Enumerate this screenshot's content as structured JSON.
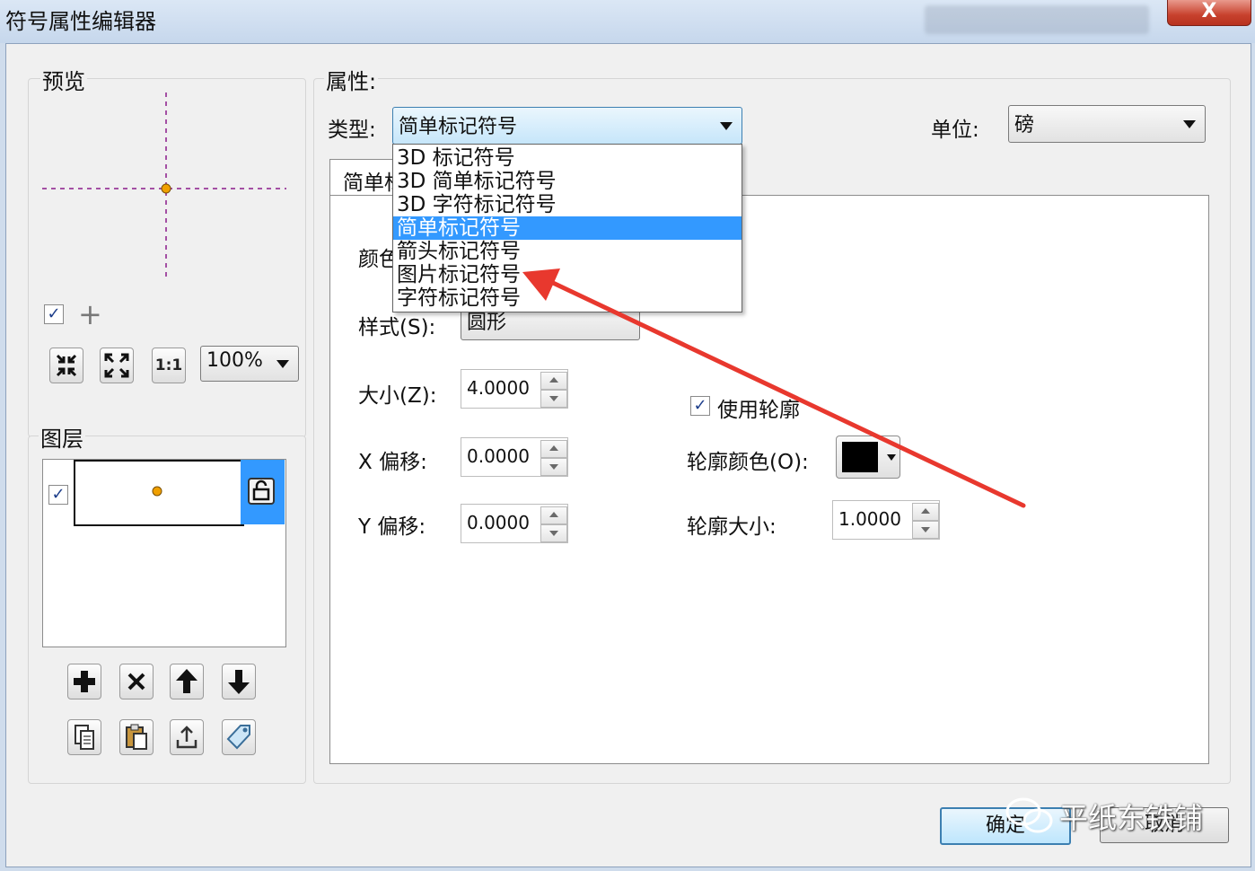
{
  "window": {
    "title": "符号属性编辑器",
    "close_glyph": "X"
  },
  "preview": {
    "label": "预览",
    "zoom_value": "100%",
    "show_crosshair_checked": true,
    "tools": [
      "zoom-in-icon",
      "zoom-extent-icon",
      "one-to-one-icon"
    ],
    "one_to_one_text": "1:1"
  },
  "layers": {
    "label": "图层",
    "items": [
      {
        "checked": true,
        "locked_icon": "lock-icon"
      }
    ],
    "buttons": [
      "add-icon",
      "delete-icon",
      "move-up-icon",
      "move-down-icon"
    ],
    "buttons2": [
      "copy-icon",
      "paste-icon",
      "export-icon",
      "tag-icon"
    ]
  },
  "properties": {
    "label": "属性:",
    "type_label": "类型:",
    "type_value": "简单标记符号",
    "unit_label": "单位:",
    "unit_value": "磅",
    "tab_label": "简单标记",
    "color_label": "颜色",
    "style_label": "样式(S):",
    "style_value": "圆形",
    "size_label": "大小(Z):",
    "size_value": "4.0000",
    "xoffset_label": "X 偏移:",
    "xoffset_value": "0.0000",
    "yoffset_label": "Y 偏移:",
    "yoffset_value": "0.0000",
    "use_outline_label": "使用轮廓",
    "use_outline_checked": true,
    "outline_color_label": "轮廓颜色(O):",
    "outline_color": "#000000",
    "outline_size_label": "轮廓大小:",
    "outline_size_value": "1.0000"
  },
  "type_dropdown": {
    "items": [
      "3D 标记符号",
      "3D 简单标记符号",
      "3D 字符标记符号",
      "简单标记符号",
      "箭头标记符号",
      "图片标记符号",
      "字符标记符号"
    ],
    "selected_index": 3
  },
  "footer": {
    "ok_label": "确定",
    "cancel_label": "取消",
    "watermark": "平纸东铁铺"
  },
  "colors": {
    "selection": "#3399ff",
    "layer_selected": "#3399ff",
    "marker": "#f0a000",
    "annotation_arrow": "#e8382e",
    "guide_lines": "#8a1a8a"
  }
}
